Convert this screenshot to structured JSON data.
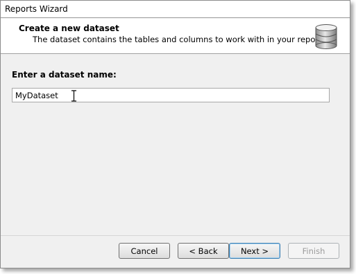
{
  "window": {
    "title": "Reports Wizard"
  },
  "header": {
    "title": "Create a new dataset",
    "subtitle": "The dataset contains the tables and columns to work with in your report.",
    "icon": "database-icon"
  },
  "form": {
    "label": "Enter a dataset name:",
    "value": "MyDataset"
  },
  "buttons": {
    "cancel": "Cancel",
    "back": "< Back",
    "next": "Next >",
    "finish": "Finish"
  }
}
